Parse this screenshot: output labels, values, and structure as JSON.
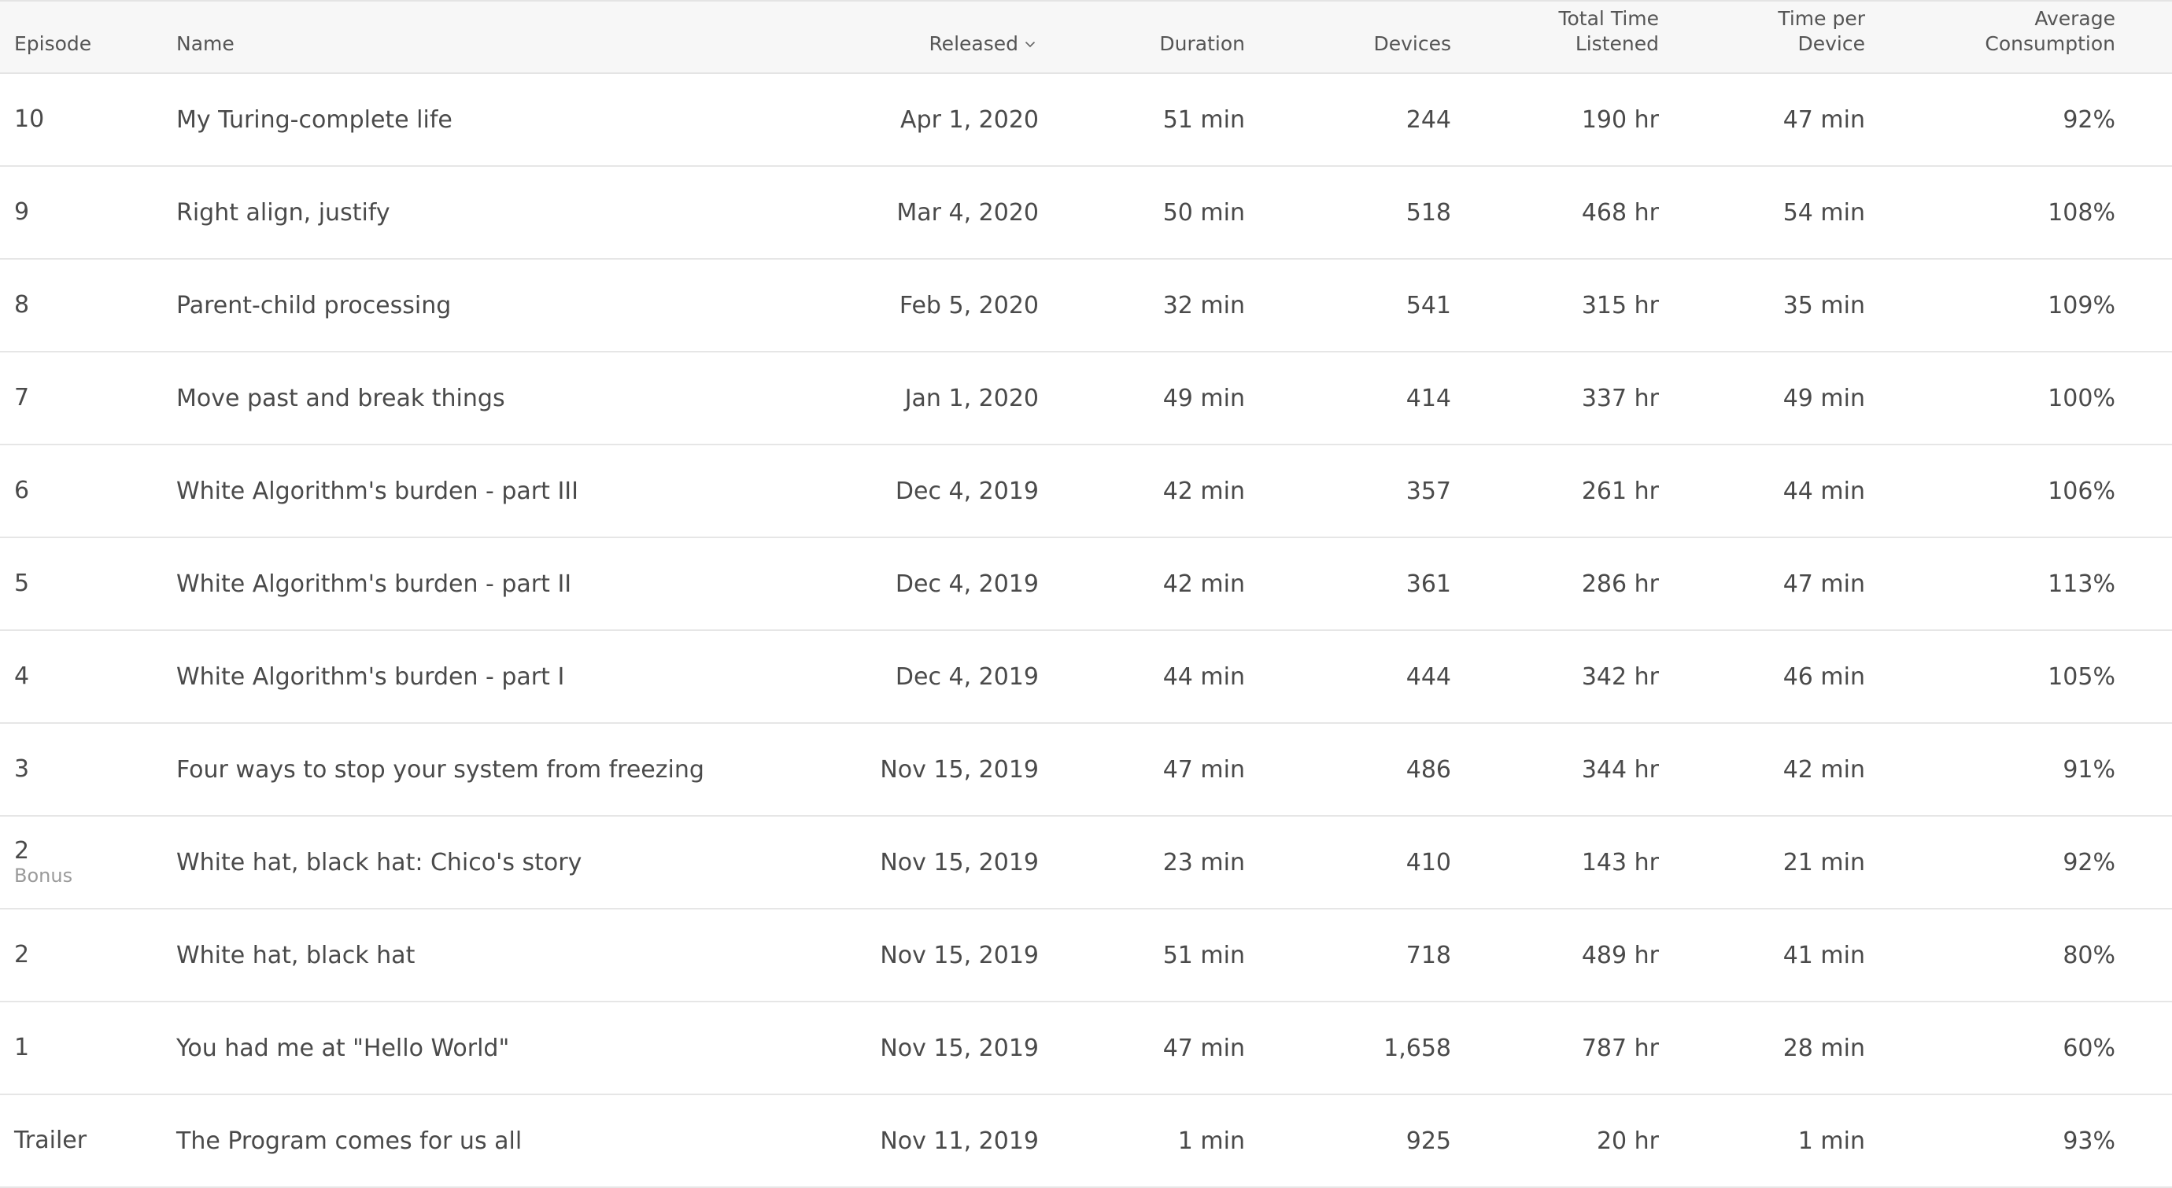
{
  "columns": {
    "episode": "Episode",
    "name": "Name",
    "released": "Released",
    "duration": "Duration",
    "devices": "Devices",
    "total_time_line1": "Total Time",
    "total_time_line2": "Listened",
    "time_per_device_line1": "Time per",
    "time_per_device_line2": "Device",
    "avg_line1": "Average",
    "avg_line2": "Consumption"
  },
  "sort": {
    "column": "released",
    "direction": "descending",
    "icon": "chevron-down-icon"
  },
  "rows": [
    {
      "episode": "10",
      "sub": "",
      "name": "My Turing-complete life",
      "released": "Apr 1, 2020",
      "duration": "51 min",
      "devices": "244",
      "total": "190 hr",
      "per_device": "47 min",
      "avg": "92%"
    },
    {
      "episode": "9",
      "sub": "",
      "name": "Right align, justify",
      "released": "Mar 4, 2020",
      "duration": "50 min",
      "devices": "518",
      "total": "468 hr",
      "per_device": "54 min",
      "avg": "108%"
    },
    {
      "episode": "8",
      "sub": "",
      "name": "Parent-child processing",
      "released": "Feb 5, 2020",
      "duration": "32 min",
      "devices": "541",
      "total": "315 hr",
      "per_device": "35 min",
      "avg": "109%"
    },
    {
      "episode": "7",
      "sub": "",
      "name": "Move past and break things",
      "released": "Jan 1, 2020",
      "duration": "49 min",
      "devices": "414",
      "total": "337 hr",
      "per_device": "49 min",
      "avg": "100%"
    },
    {
      "episode": "6",
      "sub": "",
      "name": "White Algorithm's burden - part III",
      "released": "Dec 4, 2019",
      "duration": "42 min",
      "devices": "357",
      "total": "261 hr",
      "per_device": "44 min",
      "avg": "106%"
    },
    {
      "episode": "5",
      "sub": "",
      "name": "White Algorithm's burden - part II",
      "released": "Dec 4, 2019",
      "duration": "42 min",
      "devices": "361",
      "total": "286 hr",
      "per_device": "47 min",
      "avg": "113%"
    },
    {
      "episode": "4",
      "sub": "",
      "name": "White Algorithm's burden - part I",
      "released": "Dec 4, 2019",
      "duration": "44 min",
      "devices": "444",
      "total": "342 hr",
      "per_device": "46 min",
      "avg": "105%"
    },
    {
      "episode": "3",
      "sub": "",
      "name": "Four ways to stop your system from freezing",
      "released": "Nov 15, 2019",
      "duration": "47 min",
      "devices": "486",
      "total": "344 hr",
      "per_device": "42 min",
      "avg": "91%"
    },
    {
      "episode": "2",
      "sub": "Bonus",
      "name": "White hat, black hat: Chico's story",
      "released": "Nov 15, 2019",
      "duration": "23 min",
      "devices": "410",
      "total": "143 hr",
      "per_device": "21 min",
      "avg": "92%"
    },
    {
      "episode": "2",
      "sub": "",
      "name": "White hat, black hat",
      "released": "Nov 15, 2019",
      "duration": "51 min",
      "devices": "718",
      "total": "489 hr",
      "per_device": "41 min",
      "avg": "80%"
    },
    {
      "episode": "1",
      "sub": "",
      "name": "You had me at \"Hello World\"",
      "released": "Nov 15, 2019",
      "duration": "47 min",
      "devices": "1,658",
      "total": "787 hr",
      "per_device": "28 min",
      "avg": "60%"
    },
    {
      "episode": "Trailer",
      "sub": "",
      "name": "The Program comes for us all",
      "released": "Nov 11, 2019",
      "duration": "1 min",
      "devices": "925",
      "total": "20 hr",
      "per_device": "1 min",
      "avg": "93%"
    }
  ]
}
